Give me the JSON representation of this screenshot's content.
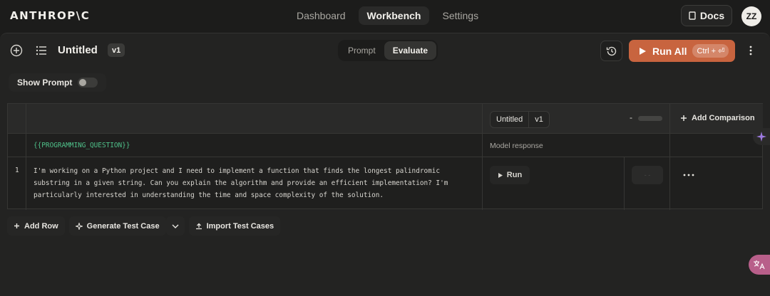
{
  "brand": "ANTHROP\\C",
  "nav": {
    "links": [
      {
        "label": "Dashboard"
      },
      {
        "label": "Workbench"
      },
      {
        "label": "Settings"
      }
    ],
    "docs_label": "Docs",
    "avatar_initials": "ZZ"
  },
  "toolbar": {
    "title": "Untitled",
    "version": "v1",
    "tabs": [
      {
        "label": "Prompt"
      },
      {
        "label": "Evaluate"
      }
    ],
    "active_tab": "Evaluate",
    "run_all_label": "Run All",
    "run_all_shortcut": "Ctrl + ⏎"
  },
  "show_prompt": {
    "label": "Show Prompt",
    "enabled": false
  },
  "table": {
    "variable_header": "{{PROGRAMMING_QUESTION}}",
    "column": {
      "name": "Untitled",
      "version": "v1",
      "sub_label": "Model response",
      "dash": "-"
    },
    "add_comparison_label": "Add Comparison",
    "rows": [
      {
        "index": "1",
        "input_lines": [
          "I'm working on a Python project and I need to implement a function that finds the longest palindromic",
          "substring in a given string. Can you explain the algorithm and provide an efficient implementation? I'm",
          "particularly interested in understanding the time and space complexity of the solution."
        ],
        "run_label": "Run",
        "rating_placeholder": "- -"
      }
    ]
  },
  "actions": {
    "add_row": "Add Row",
    "generate_test_case": "Generate Test Case",
    "import_test_cases": "Import Test Cases"
  },
  "colors": {
    "accent": "#c8643f",
    "variable": "#4fc18a",
    "background": "#1c1c1b"
  },
  "icons": [
    "add-circle-icon",
    "list-icon",
    "history-icon",
    "play-icon",
    "more-vertical-icon",
    "book-icon",
    "plus-icon",
    "sparkle-icon",
    "chevron-down-icon",
    "upload-icon",
    "translate-icon"
  ]
}
